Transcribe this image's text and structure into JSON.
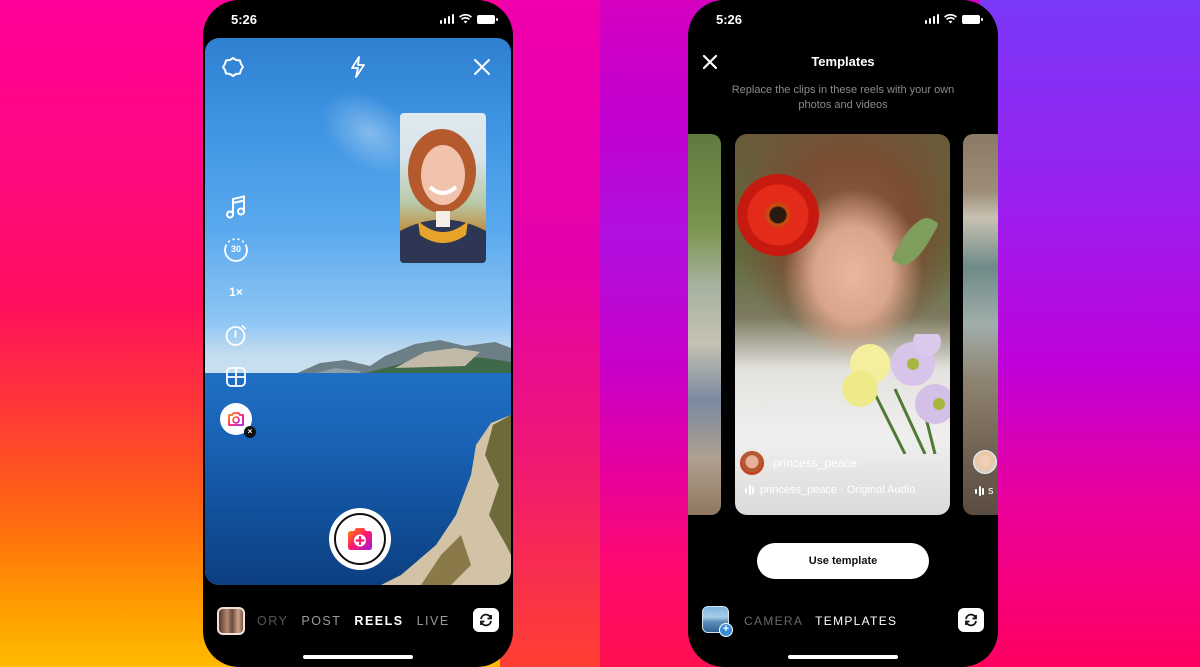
{
  "background": {
    "gradient_colors": [
      "#ff0099",
      "#ff0e5e",
      "#ff6a10",
      "#ffbb00",
      "#7a35f5",
      "#c000d8"
    ]
  },
  "left_phone": {
    "status_bar": {
      "time": "5:26"
    },
    "top_controls": [
      {
        "icon": "settings-icon"
      },
      {
        "icon": "flash-icon"
      },
      {
        "icon": "close-icon"
      }
    ],
    "side_tools": [
      {
        "icon": "music-icon",
        "label": ""
      },
      {
        "icon": "timer-30-icon",
        "label": "30"
      },
      {
        "icon": "speed-icon",
        "label": "1×"
      },
      {
        "icon": "stopwatch-icon",
        "label": ""
      },
      {
        "icon": "layout-icon",
        "label": ""
      },
      {
        "icon": "dual-camera-icon",
        "label": ""
      }
    ],
    "mode_tabs": [
      {
        "label": "ORY",
        "state": "faded"
      },
      {
        "label": "POST",
        "state": "inactive"
      },
      {
        "label": "REELS",
        "state": "active"
      },
      {
        "label": "LIVE",
        "state": "inactive"
      }
    ]
  },
  "right_phone": {
    "status_bar": {
      "time": "5:26"
    },
    "header": {
      "title": "Templates",
      "subtitle": "Replace the clips in these reels with your own photos and videos"
    },
    "cards": [
      {
        "position": "center",
        "username": "princess_peace",
        "audio": "princess_peace · Original Audio"
      },
      {
        "position": "right",
        "audio": "s"
      }
    ],
    "use_template_label": "Use template",
    "mode_tabs": [
      {
        "label": "CAMERA",
        "state": "inactive"
      },
      {
        "label": "TEMPLATES",
        "state": "active"
      }
    ]
  }
}
